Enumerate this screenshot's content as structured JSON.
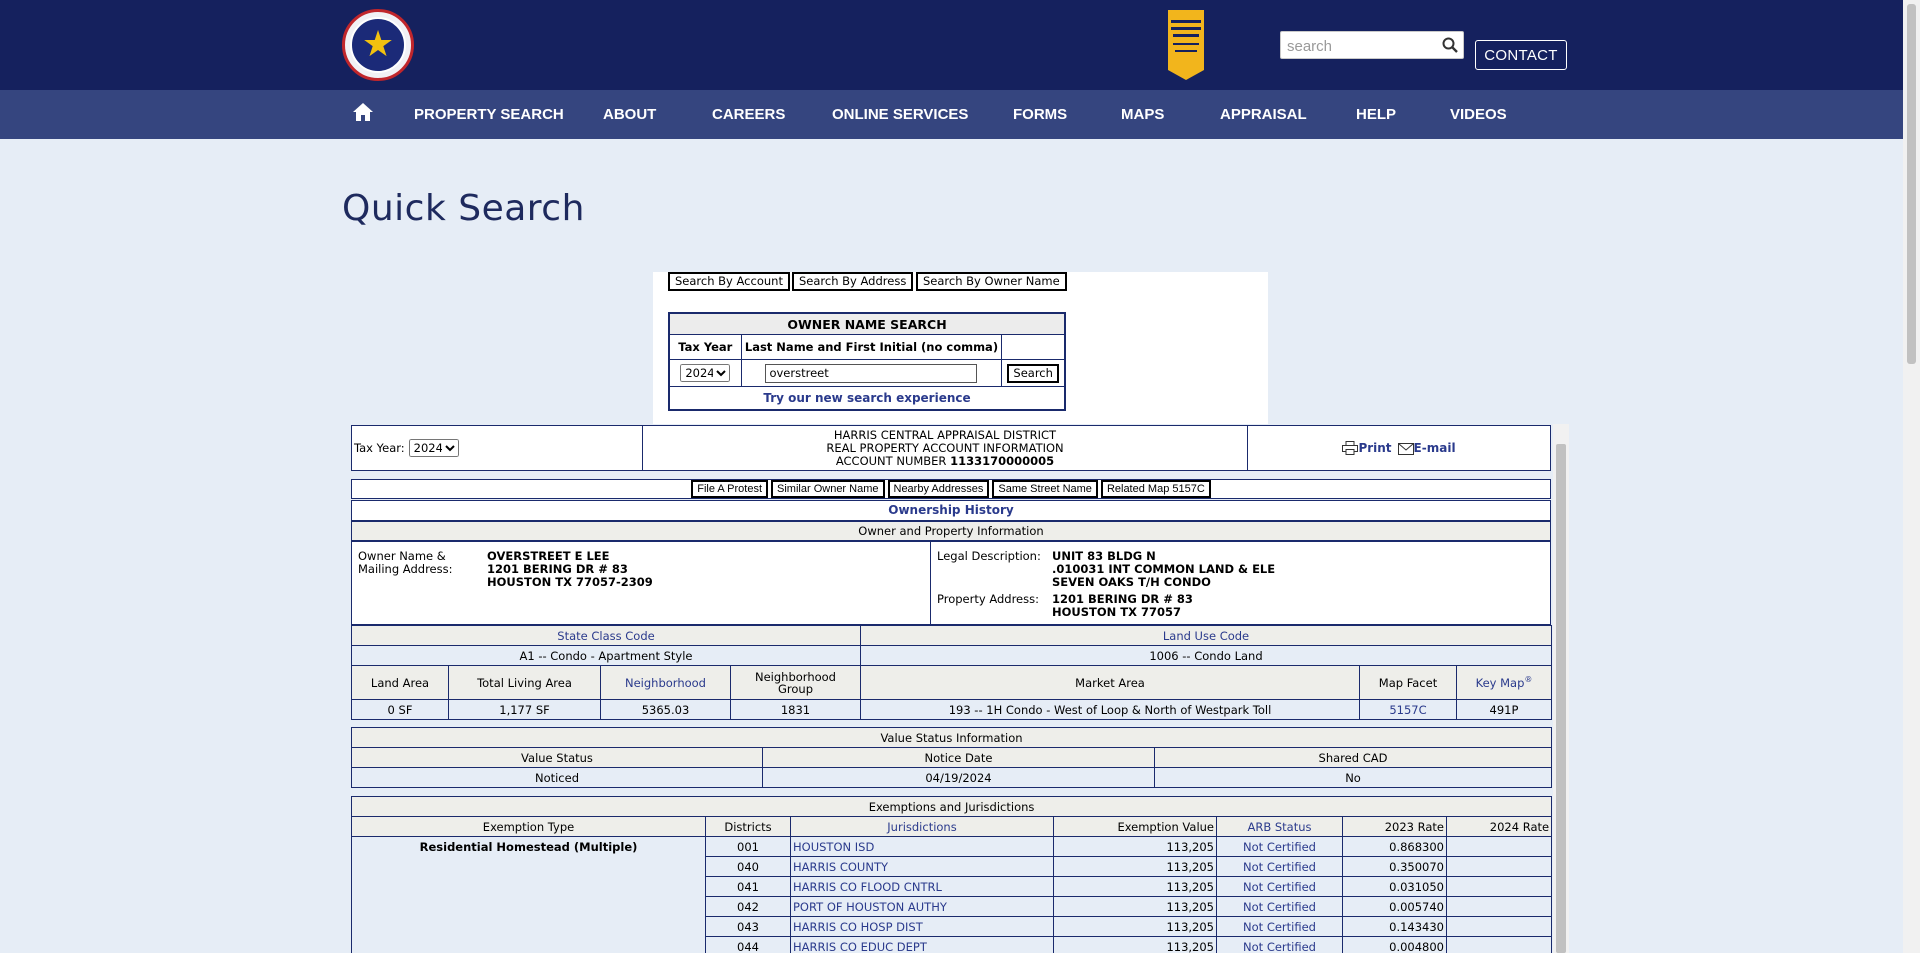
{
  "header": {
    "search_placeholder": "search",
    "contact_label": "CONTACT"
  },
  "nav": {
    "items": [
      "PROPERTY SEARCH",
      "ABOUT",
      "CAREERS",
      "ONLINE SERVICES",
      "FORMS",
      "MAPS",
      "APPRAISAL",
      "HELP",
      "VIDEOS"
    ]
  },
  "page": {
    "title": "Quick Search"
  },
  "search_panel": {
    "tabs": [
      "Search By Account",
      "Search By Address",
      "Search By Owner Name"
    ],
    "box_title": "OWNER NAME SEARCH",
    "col_tax_year": "Tax Year",
    "col_name": "Last Name and First Initial (no comma)",
    "tax_year": "2024",
    "name_value": "overstreet",
    "search_label": "Search",
    "try_link": "Try our new search experience"
  },
  "result": {
    "tax_year_label": "Tax Year:",
    "tax_year": "2024",
    "district_line1": "HARRIS CENTRAL APPRAISAL DISTRICT",
    "district_line2": "REAL PROPERTY ACCOUNT INFORMATION",
    "account_label": "ACCOUNT NUMBER",
    "account_number": "1133170000005",
    "print_label": "Print",
    "email_label": "E-mail",
    "buttons": [
      "File A Protest",
      "Similar Owner Name",
      "Nearby Addresses",
      "Same Street Name",
      "Related Map 5157C"
    ],
    "ownership_history": "Ownership History",
    "owner_section": "Owner and Property Information",
    "owner_label_1": "Owner Name &",
    "owner_label_2": "Mailing Address:",
    "owner_lines": [
      "OVERSTREET E LEE",
      "1201 BERING DR # 83",
      "HOUSTON TX 77057-2309"
    ],
    "legal_label": "Legal Description:",
    "legal_lines": [
      "UNIT 83 BLDG N",
      ".010031 INT COMMON LAND & ELE",
      "SEVEN OAKS T/H CONDO"
    ],
    "property_label": "Property Address:",
    "property_lines": [
      "1201 BERING DR # 83",
      "HOUSTON TX 77057"
    ],
    "state_class_hdr": "State Class Code",
    "land_use_hdr": "Land Use Code",
    "state_class": "A1 -- Condo - Apartment Style",
    "land_use": "1006 -- Condo Land",
    "land_area_hdr": "Land Area",
    "living_area_hdr": "Total Living Area",
    "neighborhood_hdr": "Neighborhood",
    "nbhd_group_hdr_1": "Neighborhood",
    "nbhd_group_hdr_2": "Group",
    "market_area_hdr": "Market Area",
    "map_facet_hdr": "Map Facet",
    "key_map_hdr": "Key Map",
    "key_map_sup": "®",
    "land_area": "0 SF",
    "living_area": "1,177 SF",
    "neighborhood": "5365.03",
    "nbhd_group": "1831",
    "market_area": "193 -- 1H Condo - West of Loop & North of Westpark Toll",
    "map_facet": "5157C",
    "key_map": "491P",
    "value_status_section": "Value Status Information",
    "value_status_hdr": "Value Status",
    "notice_date_hdr": "Notice Date",
    "shared_cad_hdr": "Shared CAD",
    "value_status": "Noticed",
    "notice_date": "04/19/2024",
    "shared_cad": "No",
    "exemptions_section": "Exemptions and Jurisdictions",
    "ex_hdrs": [
      "Exemption Type",
      "Districts",
      "Jurisdictions",
      "Exemption Value",
      "ARB Status",
      "2023 Rate",
      "2024 Rate"
    ],
    "exemption_type": "Residential Homestead (Multiple)",
    "jurisdictions": [
      {
        "district": "001",
        "name": "HOUSTON ISD",
        "value": "113,205",
        "arb": "Not Certified",
        "rate2023": "0.868300",
        "rate2024": ""
      },
      {
        "district": "040",
        "name": "HARRIS COUNTY",
        "value": "113,205",
        "arb": "Not Certified",
        "rate2023": "0.350070",
        "rate2024": ""
      },
      {
        "district": "041",
        "name": "HARRIS CO FLOOD CNTRL",
        "value": "113,205",
        "arb": "Not Certified",
        "rate2023": "0.031050",
        "rate2024": ""
      },
      {
        "district": "042",
        "name": "PORT OF HOUSTON AUTHY",
        "value": "113,205",
        "arb": "Not Certified",
        "rate2023": "0.005740",
        "rate2024": ""
      },
      {
        "district": "043",
        "name": "HARRIS CO HOSP DIST",
        "value": "113,205",
        "arb": "Not Certified",
        "rate2023": "0.143430",
        "rate2024": ""
      },
      {
        "district": "044",
        "name": "HARRIS CO EDUC DEPT",
        "value": "113,205",
        "arb": "Not Certified",
        "rate2023": "0.004800",
        "rate2024": ""
      }
    ]
  },
  "icons": {
    "logo": "hcad-seal-logo",
    "badge": "top-workplaces-badge",
    "search": "search-icon",
    "home": "home-icon",
    "print": "printer-icon",
    "email": "mail-icon"
  },
  "colors": {
    "header_bg": "#15215e",
    "nav_bg": "#35457f",
    "page_bg": "#e6edf6",
    "link": "#2a3a8c"
  }
}
